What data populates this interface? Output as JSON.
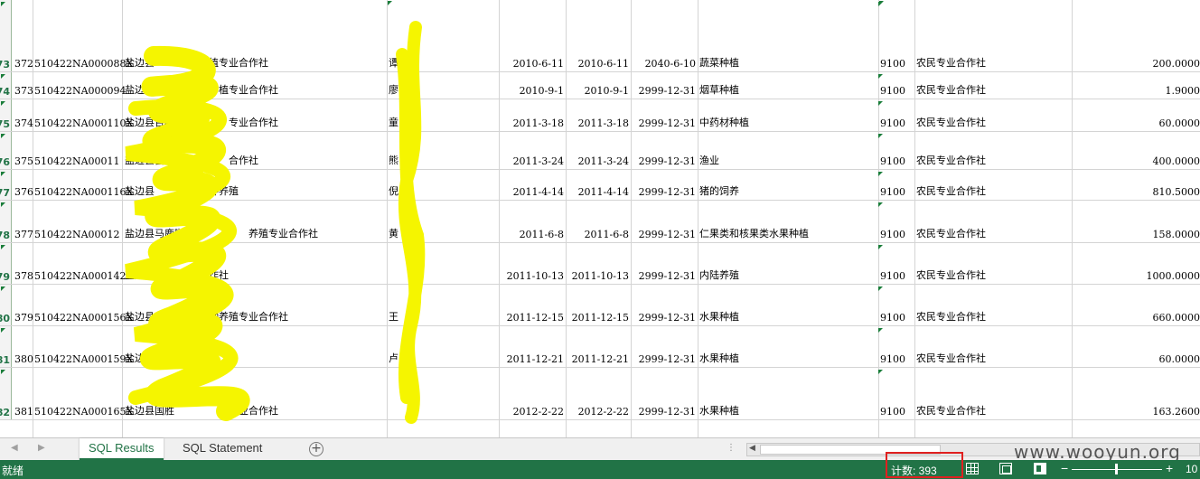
{
  "rows": [
    {
      "rownum": "73",
      "idx": "372",
      "code": "510422NA000088X",
      "name": "盐边县",
      "name_tail": "植专业合作社",
      "person": "谭",
      "start": "2010-6-11",
      "reg": "2010-6-11",
      "end": "2040-6-10",
      "scope": "蔬菜种植",
      "zip": "9100",
      "type": "农民专业合作社",
      "capital": "200.0000"
    },
    {
      "rownum": "74",
      "idx": "373",
      "code": "510422NA000094",
      "name": "盐边县",
      "name_tail": "种植专业合作社",
      "person": "廖",
      "start": "2010-9-1",
      "reg": "2010-9-1",
      "end": "2999-12-31",
      "scope": "烟草种植",
      "zip": "9100",
      "type": "农民专业合作社",
      "capital": "1.9000"
    },
    {
      "rownum": "75",
      "idx": "374",
      "code": "510422NA000110X",
      "name": "盐边县百林",
      "name_tail": "专业合作社",
      "person": "童",
      "start": "2011-3-18",
      "reg": "2011-3-18",
      "end": "2999-12-31",
      "scope": "中药材种植",
      "zip": "9100",
      "type": "农民专业合作社",
      "capital": "60.0000"
    },
    {
      "rownum": "76",
      "idx": "375",
      "code": "510422NA00011",
      "name": "盐边县富乐",
      "name_tail": "合作社",
      "person": "熊",
      "start": "2011-3-24",
      "reg": "2011-3-24",
      "end": "2999-12-31",
      "scope": "渔业",
      "zip": "9100",
      "type": "农民专业合作社",
      "capital": "400.0000"
    },
    {
      "rownum": "77",
      "idx": "376",
      "code": "510422NA000116X",
      "name": "盐边县",
      "name_tail": "种养殖",
      "person": "倪",
      "start": "2011-4-14",
      "reg": "2011-4-14",
      "end": "2999-12-31",
      "scope": "猪的饲养",
      "zip": "9100",
      "type": "农民专业合作社",
      "capital": "810.5000"
    },
    {
      "rownum": "78",
      "idx": "377",
      "code": "510422NA00012",
      "name": "盐边县马鹿咖啡",
      "name_tail": "养殖专业合作社",
      "person": "黄",
      "start": "2011-6-8",
      "reg": "2011-6-8",
      "end": "2999-12-31",
      "scope": "仁果类和核果类水果种植",
      "zip": "9100",
      "type": "农民专业合作社",
      "capital": "158.0000"
    },
    {
      "rownum": "79",
      "idx": "378",
      "code": "510422NA000142X",
      "name": "盐边县",
      "name_tail": "作社",
      "person": "",
      "start": "2011-10-13",
      "reg": "2011-10-13",
      "end": "2999-12-31",
      "scope": "内陆养殖",
      "zip": "9100",
      "type": "农民专业合作社",
      "capital": "1000.0000"
    },
    {
      "rownum": "80",
      "idx": "379",
      "code": "510422NA000156X",
      "name": "盐边县",
      "name_tail": "种养殖专业合作社",
      "person": "王",
      "start": "2011-12-15",
      "reg": "2011-12-15",
      "end": "2999-12-31",
      "scope": "水果种植",
      "zip": "9100",
      "type": "农民专业合作社",
      "capital": "660.0000"
    },
    {
      "rownum": "81",
      "idx": "380",
      "code": "510422NA000159X",
      "name": "盐边县",
      "name_tail": "",
      "person": "卢",
      "start": "2011-12-21",
      "reg": "2011-12-21",
      "end": "2999-12-31",
      "scope": "水果种植",
      "zip": "9100",
      "type": "农民专业合作社",
      "capital": "60.0000"
    },
    {
      "rownum": "82",
      "idx": "381",
      "code": "510422NA000165X",
      "name": "盐边县国胜",
      "name_tail": "专业合作社",
      "person": "",
      "start": "2012-2-22",
      "reg": "2012-2-22",
      "end": "2999-12-31",
      "scope": "水果种植",
      "zip": "9100",
      "type": "农民专业合作社",
      "capital": "163.2600"
    }
  ],
  "sheet_tabs": {
    "results": "SQL Results",
    "statement": "SQL Statement"
  },
  "add_sheet": "+",
  "status": {
    "ready": "就绪",
    "count": "计数: 393",
    "zoom": "10"
  },
  "watermark": "www.wooyun.org",
  "colors": {
    "accent": "#217346",
    "highlight_box": "#e02020",
    "scribble": "#f5f500"
  },
  "icons": [
    "nav-left-icon",
    "nav-right-icon",
    "add-sheet-icon",
    "normal-view-icon",
    "page-layout-icon",
    "page-break-icon"
  ]
}
